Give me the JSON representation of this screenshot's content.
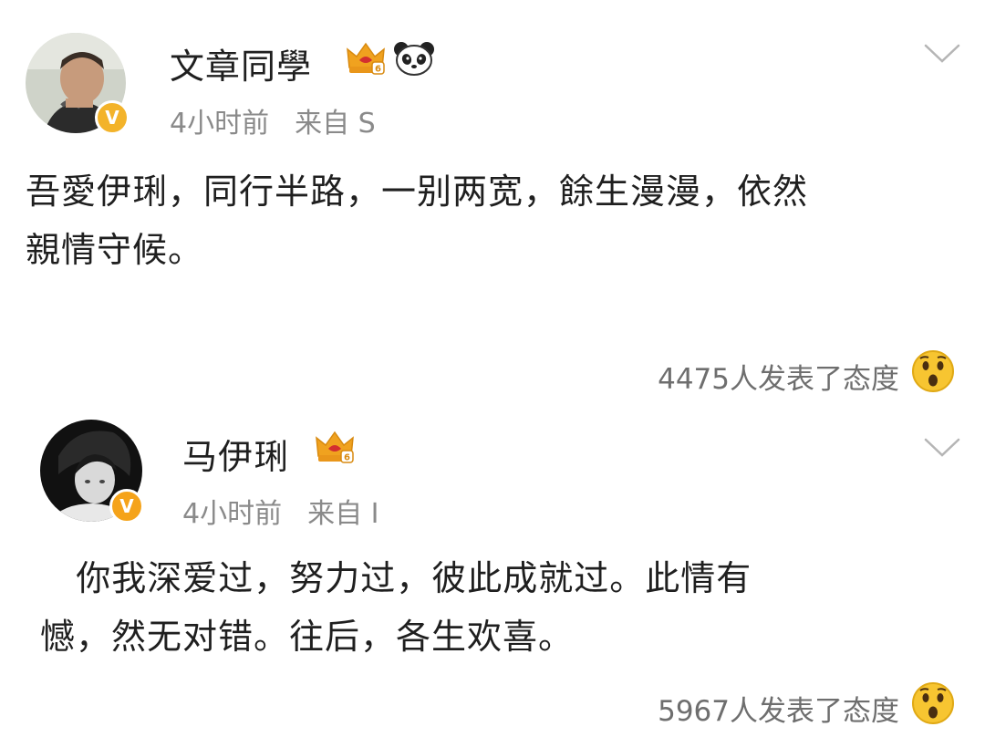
{
  "posts": [
    {
      "author": "文章同學",
      "time": "4小时前",
      "source": "来自 S",
      "content": "吾愛伊琍，同行半路，一别两宽，餘生漫漫，依然\n親情守候。",
      "reactions": "4475人发表了态度",
      "verified_badge": "V",
      "icons": [
        "crown-icon",
        "panda-icon",
        "chevron-down-icon",
        "wow-emoji-icon"
      ],
      "colors": {
        "badge": "#f3b32a",
        "crown": "#f0a21f"
      }
    },
    {
      "author": "马伊琍",
      "time": "4小时前",
      "source": "来自 I",
      "content": "   你我深爱过，努力过，彼此成就过。此情有\n憾，然无对错。往后，各生欢喜。",
      "reactions": "5967人发表了态度",
      "verified_badge": "V",
      "icons": [
        "crown-icon",
        "chevron-down-icon",
        "wow-emoji-icon"
      ],
      "colors": {
        "badge": "#f5a31a",
        "crown": "#f0a21f"
      }
    }
  ]
}
